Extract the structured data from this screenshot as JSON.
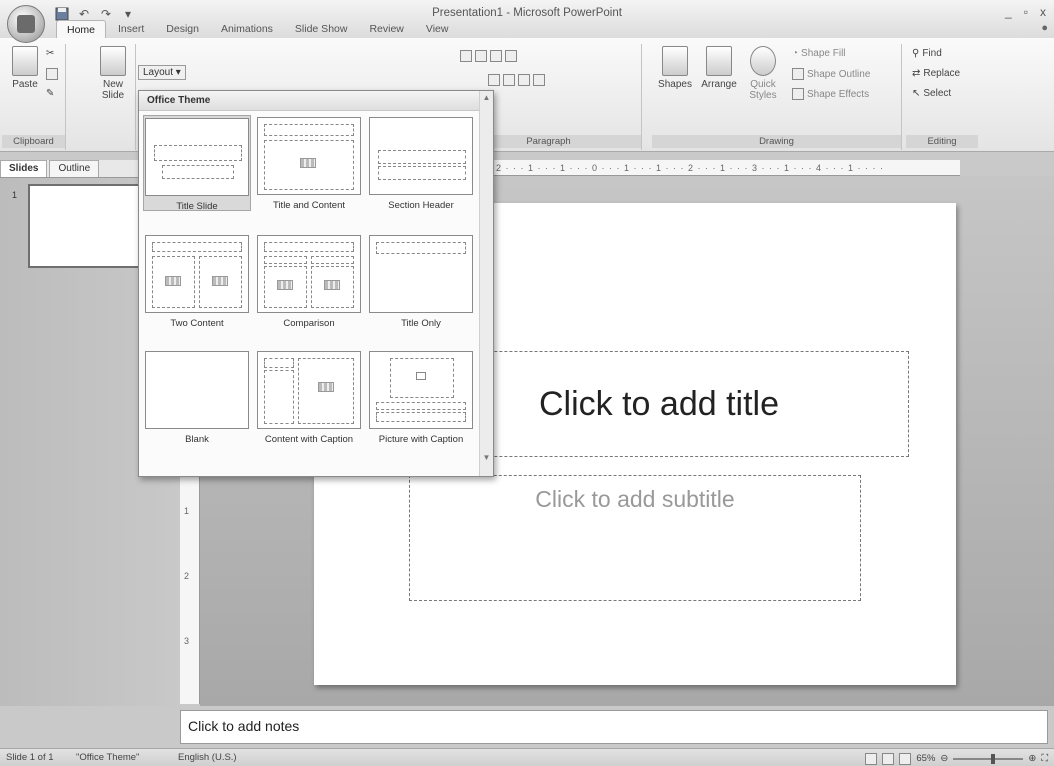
{
  "window": {
    "title": "Presentation1 - Microsoft PowerPoint",
    "controls": [
      "_",
      "▫",
      "x"
    ]
  },
  "quick_access": {
    "save_icon": "save-icon",
    "undo_icon": "undo-icon",
    "redo_icon": "redo-icon",
    "customize": "▾"
  },
  "tabs": [
    {
      "label": "Home",
      "active": true
    },
    {
      "label": "Insert"
    },
    {
      "label": "Design"
    },
    {
      "label": "Animations"
    },
    {
      "label": "Slide Show"
    },
    {
      "label": "Review"
    },
    {
      "label": "View"
    }
  ],
  "ribbon": {
    "clipboard": {
      "paste": "Paste",
      "group": "Clipboard"
    },
    "slides": {
      "new_slide": "New Slide",
      "layout": "Layout"
    },
    "paragraph": {
      "group": "Paragraph"
    },
    "drawing": {
      "shapes": "Shapes",
      "arrange": "Arrange",
      "quick_styles": "Quick Styles",
      "shape_fill": "Shape Fill",
      "shape_outline": "Shape Outline",
      "shape_effects": "Shape Effects",
      "group": "Drawing"
    },
    "editing": {
      "find": "Find",
      "replace": "Replace",
      "select": "Select",
      "group": "Editing"
    }
  },
  "layout_gallery": {
    "header": "Office Theme",
    "items": [
      {
        "label": "Title Slide",
        "selected": true
      },
      {
        "label": "Title and Content"
      },
      {
        "label": "Section Header"
      },
      {
        "label": "Two Content"
      },
      {
        "label": "Comparison"
      },
      {
        "label": "Title Only"
      },
      {
        "label": "Blank"
      },
      {
        "label": "Content with Caption"
      },
      {
        "label": "Picture with Caption"
      }
    ]
  },
  "panel_tabs": {
    "slides": "Slides",
    "outline": "Outline"
  },
  "thumbnail": {
    "number": "1"
  },
  "ruler": {
    "text": "2 · · · 1 · · · 1 · · · 0 · · · 1 · · · 1 · · · 2 · · · 1 · · · 3 · · · 1 · · · 4 · · · 1 · · · ·"
  },
  "vertical_ruler": {
    "marks": [
      "1",
      "2",
      "3"
    ]
  },
  "slide": {
    "title_placeholder": "Click to add title",
    "subtitle_placeholder": "Click to add subtitle"
  },
  "notes": {
    "placeholder": "Click to add notes"
  },
  "statusbar": {
    "slide_info": "Slide 1 of 1",
    "theme": "\"Office Theme\"",
    "language": "English (U.S.)",
    "zoom": "65%"
  }
}
